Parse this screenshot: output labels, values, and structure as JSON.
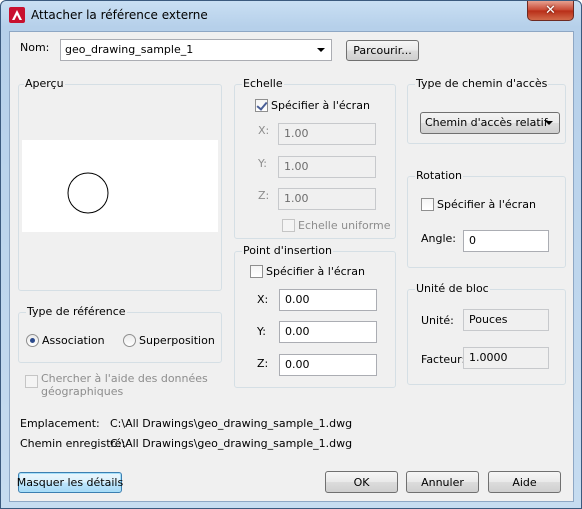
{
  "window": {
    "title": "Attacher la référence externe"
  },
  "nom": {
    "label": "Nom:",
    "value": "geo_drawing_sample_1",
    "browse_label": "Parcourir..."
  },
  "apercu": {
    "title": "Aperçu"
  },
  "echelle": {
    "title": "Echelle",
    "specify_label": "Spécifier à l'écran",
    "specify_checked": true,
    "x_label": "X:",
    "x_value": "1.00",
    "y_label": "Y:",
    "y_value": "1.00",
    "z_label": "Z:",
    "z_value": "1.00",
    "uniform_label": "Echelle uniforme"
  },
  "path_type": {
    "title": "Type de chemin d'accès",
    "selected": "Chemin d'accès relatif"
  },
  "rotation": {
    "title": "Rotation",
    "specify_label": "Spécifier à l'écran",
    "angle_label": "Angle:",
    "angle_value": "0"
  },
  "insertion": {
    "title": "Point d'insertion",
    "specify_label": "Spécifier à l'écran",
    "x_label": "X:",
    "x_value": "0.00",
    "y_label": "Y:",
    "y_value": "0.00",
    "z_label": "Z:",
    "z_value": "0.00"
  },
  "block_unit": {
    "title": "Unité de bloc",
    "unit_label": "Unité:",
    "unit_value": "Pouces",
    "factor_label": "Facteur:",
    "factor_value": "1.0000"
  },
  "ref_type": {
    "title": "Type de référence",
    "option1": "Association",
    "option2": "Superposition",
    "selected": "Association"
  },
  "geo": {
    "label_line1": "Chercher à l'aide des données",
    "label_line2": "géographiques"
  },
  "location": {
    "label": "Emplacement:",
    "value": "C:\\All Drawings\\geo_drawing_sample_1.dwg"
  },
  "saved_path": {
    "label": "Chemin enregistré:",
    "value": "C:\\All Drawings\\geo_drawing_sample_1.dwg"
  },
  "buttons": {
    "hide_details": "Masquer les détails",
    "ok": "OK",
    "cancel": "Annuler",
    "help": "Aide"
  },
  "colors": {
    "title_bar": "#b9d3ee",
    "close": "#c7442f",
    "dialog_bg": "#f0f0f0"
  }
}
